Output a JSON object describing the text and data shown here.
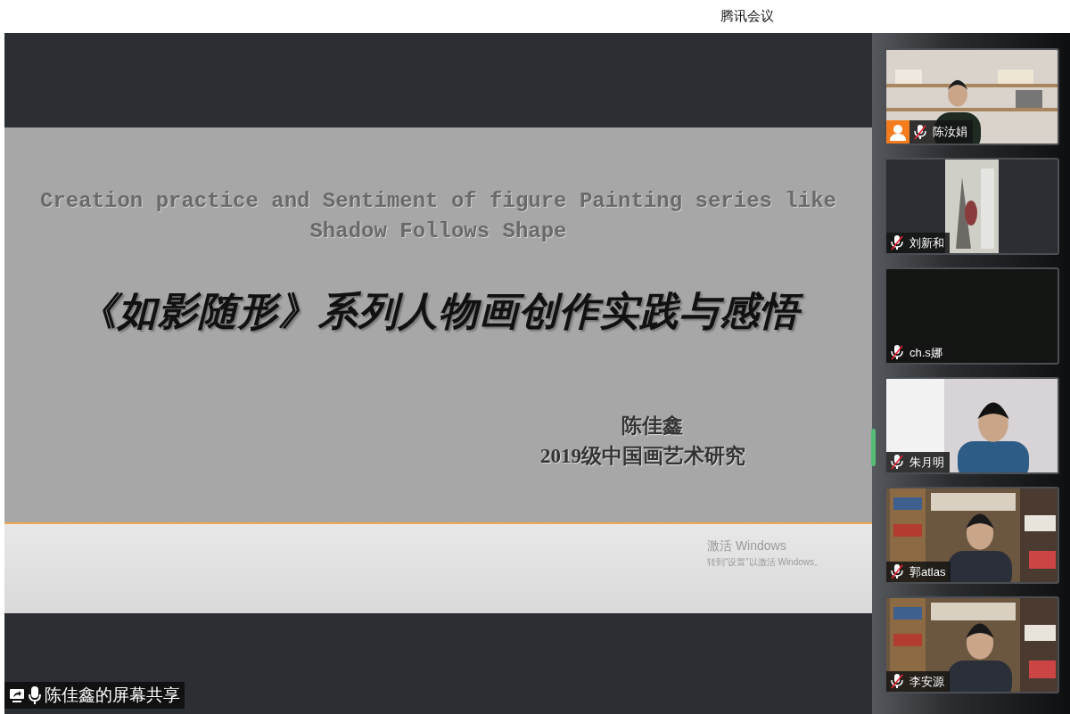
{
  "window": {
    "title": "腾讯会议"
  },
  "slide": {
    "title_en_lines": [
      "Creation practice and Sentiment of figure Painting series like",
      "Shadow Follows Shape"
    ],
    "title_zh": "《如影随形》系列人物画创作实践与感悟",
    "author": "陈佳鑫",
    "affiliation": "2019级中国画艺术研究"
  },
  "activation_notice": {
    "heading": "激活 Windows",
    "detail": "转到“设置”以激活 Windows。"
  },
  "share_label": {
    "text": "陈佳鑫的屏幕共享"
  },
  "participants": [
    {
      "name": "陈汝娟",
      "muted": true,
      "avatar_badge": true,
      "kind": "shelves"
    },
    {
      "name": "刘新和",
      "muted": true,
      "avatar_badge": false,
      "kind": "narrow"
    },
    {
      "name": "ch.s娜",
      "muted": true,
      "avatar_badge": false,
      "kind": "blank"
    },
    {
      "name": "朱月明",
      "muted": true,
      "avatar_badge": false,
      "kind": "wall"
    },
    {
      "name": "郭atlas",
      "muted": true,
      "avatar_badge": false,
      "kind": "books"
    },
    {
      "name": "李安源",
      "muted": true,
      "avatar_badge": false,
      "kind": "books"
    }
  ]
}
